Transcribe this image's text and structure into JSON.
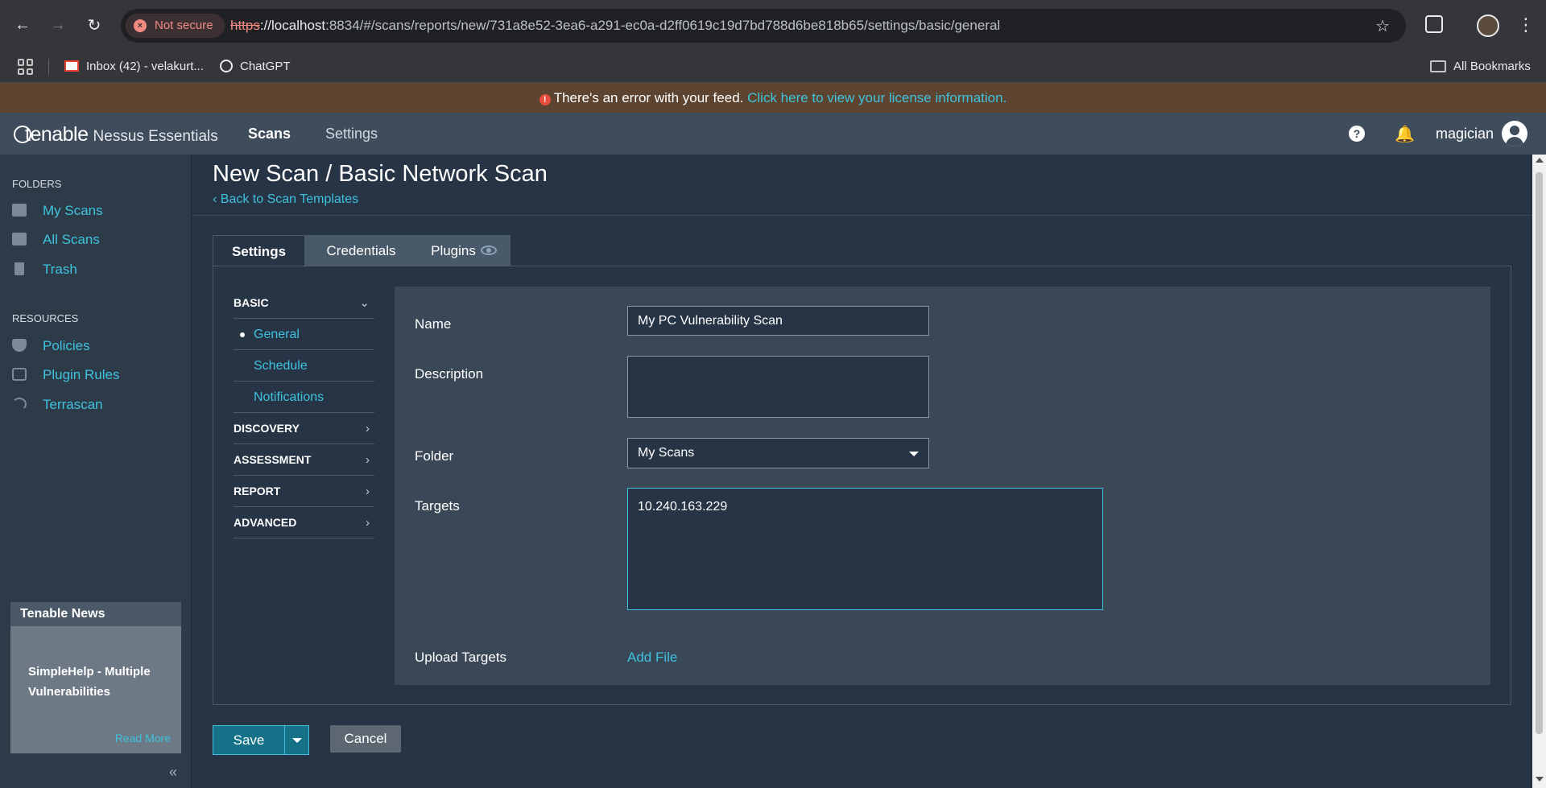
{
  "browser": {
    "not_secure_label": "Not secure",
    "url_scheme": "https",
    "url_host": "://localhost",
    "url_rest": ":8834/#/scans/reports/new/731a8e52-3ea6-a291-ec0a-d2ff0619c19d7bd788d6be818b65/settings/basic/general",
    "bookmarks": [
      {
        "label": "Inbox (42) - velakurt...",
        "icon": "gmail-icon"
      },
      {
        "label": "ChatGPT",
        "icon": "chatgpt-icon"
      }
    ],
    "all_bookmarks_label": "All Bookmarks"
  },
  "alert": {
    "message": "There's an error with your feed.",
    "link_text": "Click here to view your license information."
  },
  "header": {
    "logo_text": "tenable",
    "product_name": "Nessus Essentials",
    "nav": [
      "Scans",
      "Settings"
    ],
    "user_name": "magician"
  },
  "sidebar": {
    "folders_heading": "FOLDERS",
    "folders": [
      "My Scans",
      "All Scans",
      "Trash"
    ],
    "resources_heading": "RESOURCES",
    "resources": [
      "Policies",
      "Plugin Rules",
      "Terrascan"
    ],
    "news": {
      "heading": "Tenable News",
      "headline": "SimpleHelp - Multiple Vulnerabilities",
      "read_more": "Read More"
    }
  },
  "page": {
    "title": "New Scan / Basic Network Scan",
    "back_link": "Back to Scan Templates",
    "tabs": [
      "Settings",
      "Credentials",
      "Plugins"
    ]
  },
  "subnav": {
    "basic": "BASIC",
    "basic_items": [
      "General",
      "Schedule",
      "Notifications"
    ],
    "sections": [
      "DISCOVERY",
      "ASSESSMENT",
      "REPORT",
      "ADVANCED"
    ]
  },
  "form": {
    "name_label": "Name",
    "name_value": "My PC Vulnerability Scan",
    "description_label": "Description",
    "description_value": "",
    "folder_label": "Folder",
    "folder_value": "My Scans",
    "targets_label": "Targets",
    "targets_value": "10.240.163.229",
    "upload_label": "Upload Targets",
    "add_file": "Add File"
  },
  "actions": {
    "save": "Save",
    "cancel": "Cancel"
  },
  "colors": {
    "accent": "#3fc2dd",
    "header_bg": "#3e4c5c",
    "sidebar_bg": "#2d3b49",
    "main_bg": "#263445",
    "alert_bg": "#5c4430"
  }
}
